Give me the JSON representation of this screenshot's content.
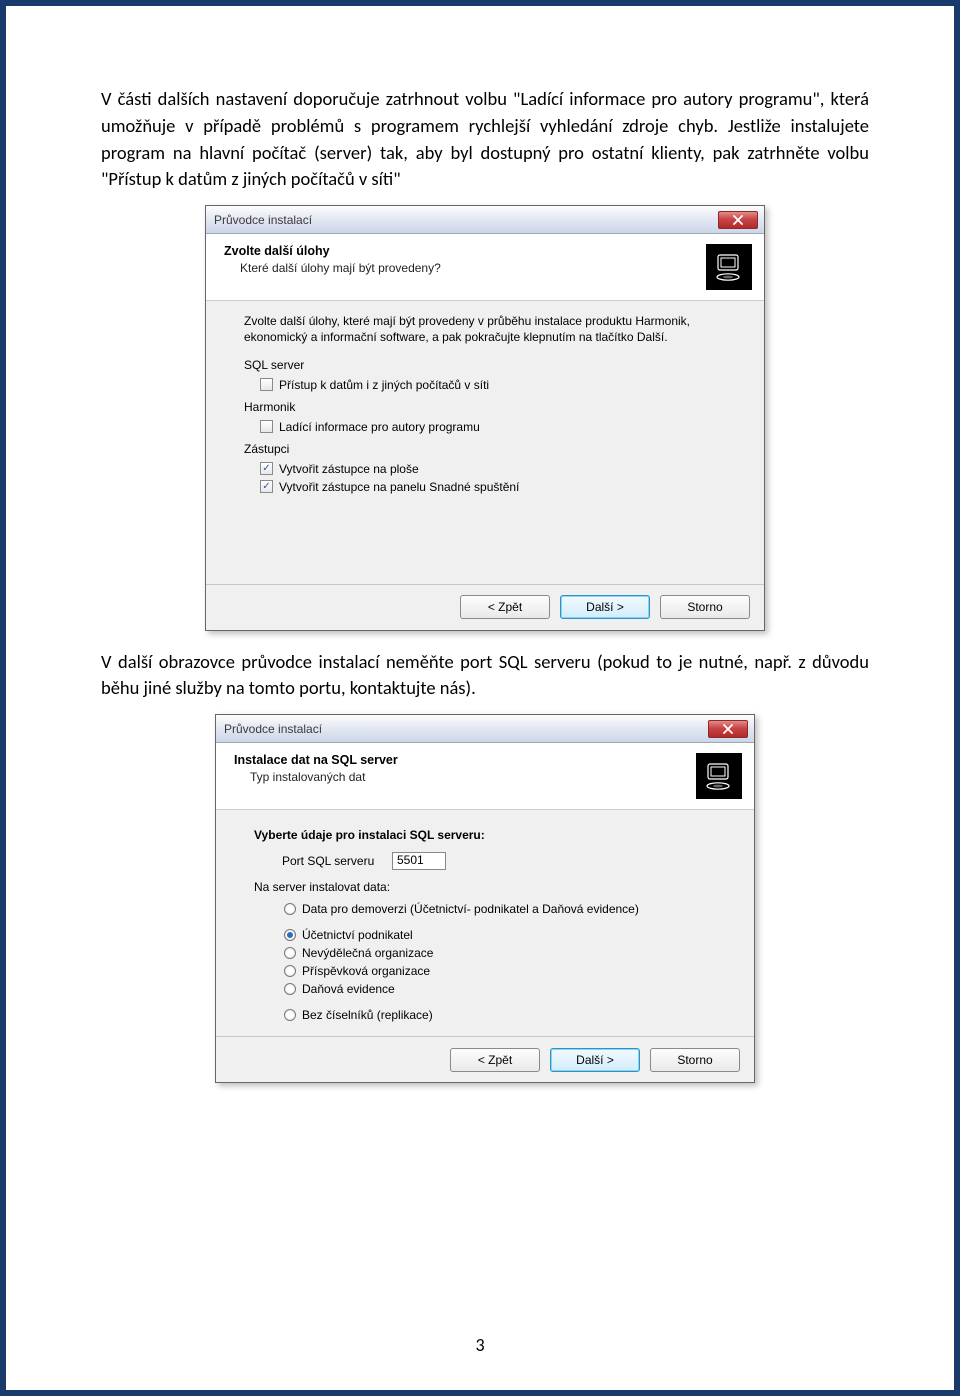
{
  "paragraphs": {
    "p1": "V části dalších nastavení doporučuje zatrhnout volbu \"Ladící informace pro autory programu\", která umožňuje v případě problémů s programem rychlejší vyhledání zdroje chyb. Jestliže instalujete program na hlavní počítač (server) tak, aby byl dostupný pro ostatní klienty, pak zatrhněte volbu \"Přístup k datům z jiných počítačů v síti\"",
    "p2": "V další obrazovce průvodce instalací neměňte port SQL serveru (pokud to je nutné, např. z důvodu běhu jiné služby na tomto portu, kontaktujte nás)."
  },
  "dialog1": {
    "title": "Průvodce instalací",
    "heading": "Zvolte další úlohy",
    "sub": "Které další úlohy mají být provedeny?",
    "intro": "Zvolte další úlohy, které mají být provedeny v průběhu instalace produktu Harmonik, ekonomický a informační software, a pak pokračujte klepnutím na tlačítko Další.",
    "sections": {
      "sql": "SQL server",
      "harmonik": "Harmonik",
      "zastupci": "Zástupci"
    },
    "checks": {
      "c1": "Přístup k datům i z jiných počítačů v síti",
      "c2": "Ladící informace pro autory programu",
      "c3": "Vytvořit zástupce na ploše",
      "c4": "Vytvořit zástupce na panelu Snadné spuštění"
    },
    "buttons": {
      "back": "< Zpět",
      "next": "Další >",
      "cancel": "Storno"
    }
  },
  "dialog2": {
    "title": "Průvodce instalací",
    "heading": "Instalace dat na SQL server",
    "sub": "Typ instalovaných dat",
    "prompt": "Vyberte údaje pro instalaci SQL serveru:",
    "port_label": "Port SQL serveru",
    "port_value": "5501",
    "install_label": "Na server instalovat data:",
    "radios": {
      "r1": "Data pro demoverzi (Účetnictví- podnikatel a Daňová evidence)",
      "r2": "Účetnictví podnikatel",
      "r3": "Nevýdělečná organizace",
      "r4": "Příspěvková organizace",
      "r5": "Daňová evidence",
      "r6": "Bez číselníků (replikace)"
    },
    "buttons": {
      "back": "< Zpět",
      "next": "Další >",
      "cancel": "Storno"
    }
  },
  "page_number": "3"
}
